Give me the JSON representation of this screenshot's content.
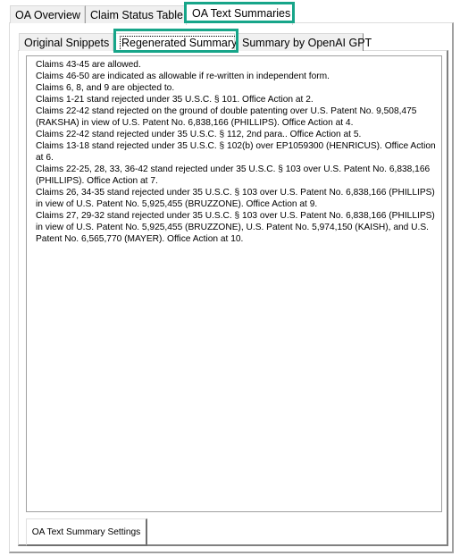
{
  "outer_tabs": [
    {
      "label": "OA Overview",
      "active": false
    },
    {
      "label": "Claim Status Table",
      "active": false
    },
    {
      "label": "OA Text Summaries",
      "active": true
    }
  ],
  "inner_tabs": [
    {
      "label": "Original Snippets",
      "active": false
    },
    {
      "label": "Regenerated Summary",
      "active": true
    },
    {
      "label": "Summary by OpenAI GPT",
      "active": false
    }
  ],
  "highlight_color": "#17a589",
  "summary_lines": [
    "Claims 43-45 are allowed.",
    "Claims 46-50 are indicated as allowable if re-written in independent form.",
    "Claims 6, 8, and 9 are objected to.",
    "Claims 1-21 stand rejected under 35 U.S.C. § 101. Office Action at 2.",
    "Claims 22-42 stand rejected on the ground of double patenting over U.S. Patent No. 9,508,475 (RAKSHA) in view of U.S. Patent No. 6,838,166  (PHILLIPS). Office Action at 4.",
    "Claims 22-42 stand rejected under 35 U.S.C. § 112, 2nd para.. Office Action at 5.",
    "Claims 13-18 stand rejected under 35 U.S.C. § 102(b) over EP1059300 (HENRICUS). Office Action at 6.",
    "Claims 22-25, 28, 33, 36-42 stand rejected under 35 U.S.C. § 103 over U.S. Patent No. 6,838,166 (PHILLIPS). Office Action at 7.",
    "Claims 26, 34-35 stand rejected under 35 U.S.C. § 103 over U.S. Patent No. 6,838,166  (PHILLIPS) in view of U.S. Patent No. 5,925,455  (BRUZZONE). Office Action at 9.",
    "Claims 27, 29-32 stand rejected under 35 U.S.C. § 103 over U.S. Patent No. 6,838,166  (PHILLIPS) in view of U.S. Patent No. 5,925,455  (BRUZZONE), U.S. Patent No. 5,974,150  (KAISH), and U.S. Patent No. 6,565,770  (MAYER). Office Action at 10."
  ],
  "settings_button": "OA Text Summary Settings"
}
